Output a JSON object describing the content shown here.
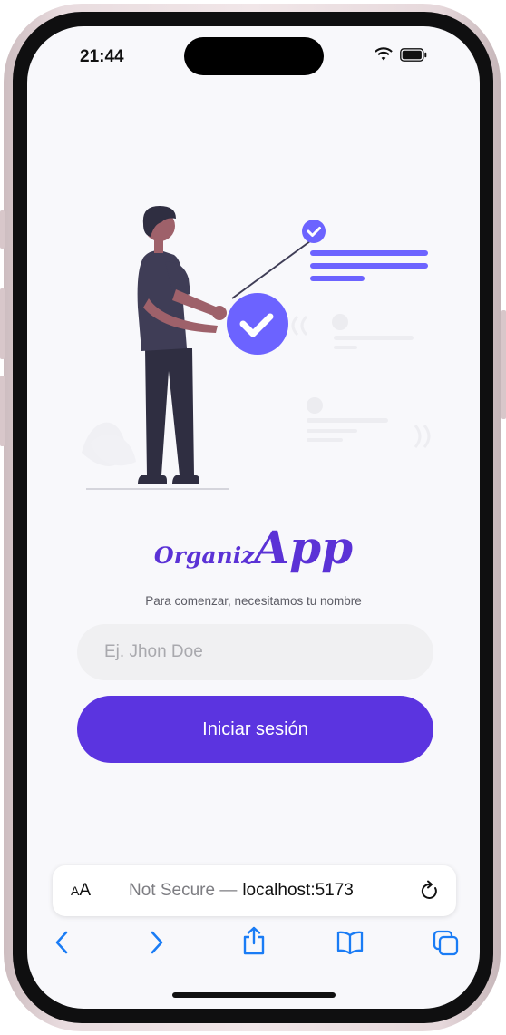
{
  "status_bar": {
    "time": "21:44"
  },
  "app": {
    "logo_prefix": "Organiz",
    "logo_suffix": "App",
    "subtitle": "Para comenzar, necesitamos tu nombre",
    "name_input": {
      "placeholder": "Ej. Jhon Doe",
      "value": ""
    },
    "login_button": "Iniciar sesión"
  },
  "browser": {
    "text_size_label": {
      "big": "A",
      "small": "A"
    },
    "security": "Not Secure —",
    "host": "localhost:5173",
    "toolbar_icons": [
      "back-icon",
      "forward-icon",
      "share-icon",
      "bookmarks-icon",
      "tabs-icon"
    ]
  },
  "colors": {
    "accent": "#5b34e0",
    "logo": "#5b32d6",
    "illustration_accent": "#6c63ff",
    "ios_blue": "#1a7cf5"
  }
}
